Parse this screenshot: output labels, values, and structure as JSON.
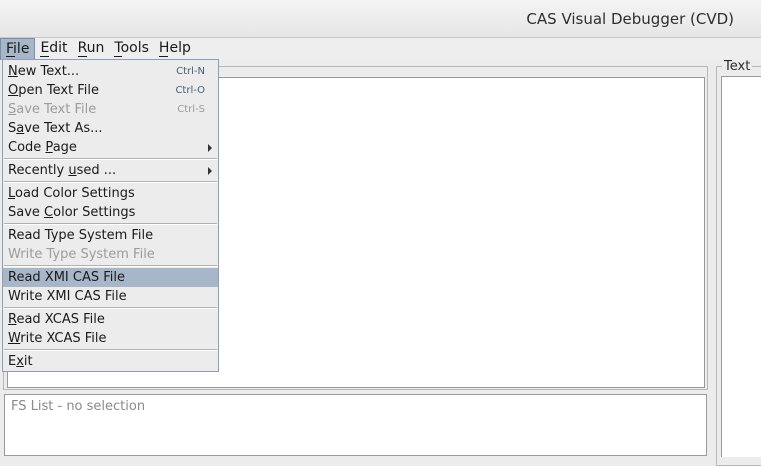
{
  "window": {
    "title": "CAS Visual Debugger (CVD)"
  },
  "menubar": {
    "items": [
      {
        "label": "File",
        "mnemonic": "F"
      },
      {
        "label": "Edit",
        "mnemonic": "E"
      },
      {
        "label": "Run",
        "mnemonic": "R"
      },
      {
        "label": "Tools",
        "mnemonic": "T"
      },
      {
        "label": "Help",
        "mnemonic": "H"
      }
    ],
    "active": "File"
  },
  "file_menu": {
    "items": [
      {
        "pre": "",
        "mn": "N",
        "post": "ew Text...",
        "accel": "Ctrl-N",
        "enabled": true
      },
      {
        "pre": "",
        "mn": "O",
        "post": "pen Text File",
        "accel": "Ctrl-O",
        "enabled": true
      },
      {
        "pre": "",
        "mn": "S",
        "post": "ave Text File",
        "accel": "Ctrl-S",
        "enabled": false
      },
      {
        "pre": "S",
        "mn": "a",
        "post": "ve Text As...",
        "accel": "",
        "enabled": true
      },
      {
        "pre": "Code ",
        "mn": "P",
        "post": "age",
        "accel": "",
        "enabled": true,
        "submenu": true
      },
      {
        "pre": "Recently ",
        "mn": "u",
        "post": "sed ...",
        "accel": "",
        "enabled": true,
        "submenu": true
      },
      {
        "pre": "",
        "mn": "L",
        "post": "oad Color Settings",
        "accel": "",
        "enabled": true
      },
      {
        "pre": "Save ",
        "mn": "C",
        "post": "olor Settings",
        "accel": "",
        "enabled": true
      },
      {
        "pre": "Read Type System File",
        "mn": "",
        "post": "",
        "accel": "",
        "enabled": true
      },
      {
        "pre": "Write Type System File",
        "mn": "",
        "post": "",
        "accel": "",
        "enabled": false
      },
      {
        "pre": "Read XMI CAS File",
        "mn": "",
        "post": "",
        "accel": "",
        "enabled": true,
        "selected": true
      },
      {
        "pre": "Write XMI CAS File",
        "mn": "",
        "post": "",
        "accel": "",
        "enabled": true
      },
      {
        "pre": "",
        "mn": "R",
        "post": "ead XCAS File",
        "accel": "",
        "enabled": true
      },
      {
        "pre": "",
        "mn": "W",
        "post": "rite XCAS File",
        "accel": "",
        "enabled": true
      },
      {
        "pre": "E",
        "mn": "x",
        "post": "it",
        "accel": "",
        "enabled": true
      }
    ]
  },
  "fs_list": {
    "label": "FS List - no selection"
  },
  "text_panel": {
    "title": "Text"
  }
}
